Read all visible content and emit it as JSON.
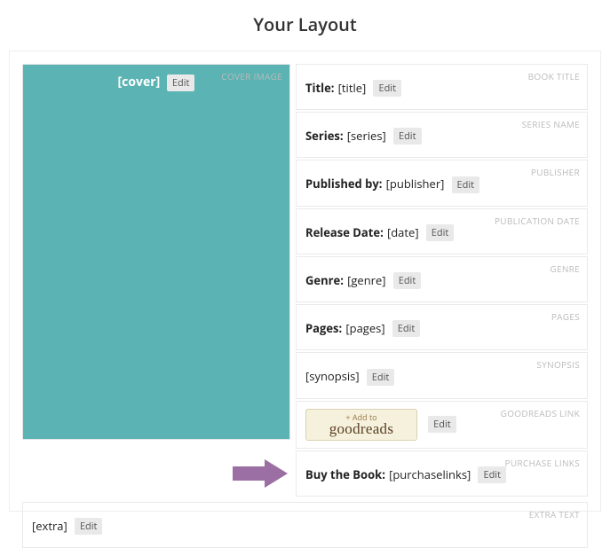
{
  "page_title": "Your Layout",
  "edit_label": "Edit",
  "cover": {
    "tag": "COVER IMAGE",
    "placeholder": "[cover]"
  },
  "fields": {
    "title": {
      "tag": "BOOK TITLE",
      "label": "Title:",
      "value": "[title]"
    },
    "series": {
      "tag": "SERIES NAME",
      "label": "Series:",
      "value": "[series]"
    },
    "publisher": {
      "tag": "PUBLISHER",
      "label": "Published by:",
      "value": "[publisher]"
    },
    "date": {
      "tag": "PUBLICATION DATE",
      "label": "Release Date:",
      "value": "[date]"
    },
    "genre": {
      "tag": "GENRE",
      "label": "Genre:",
      "value": "[genre]"
    },
    "pages": {
      "tag": "PAGES",
      "label": "Pages:",
      "value": "[pages]"
    },
    "synopsis": {
      "tag": "SYNOPSIS",
      "value": "[synopsis]"
    },
    "goodreads": {
      "tag": "GOODREADS LINK",
      "add_text": "+ Add to",
      "brand": "goodreads"
    },
    "purchase": {
      "tag": "PURCHASE LINKS",
      "label": "Buy the Book:",
      "value": "[purchaselinks]"
    },
    "extra": {
      "tag": "EXTRA TEXT",
      "value": "[extra]"
    }
  }
}
